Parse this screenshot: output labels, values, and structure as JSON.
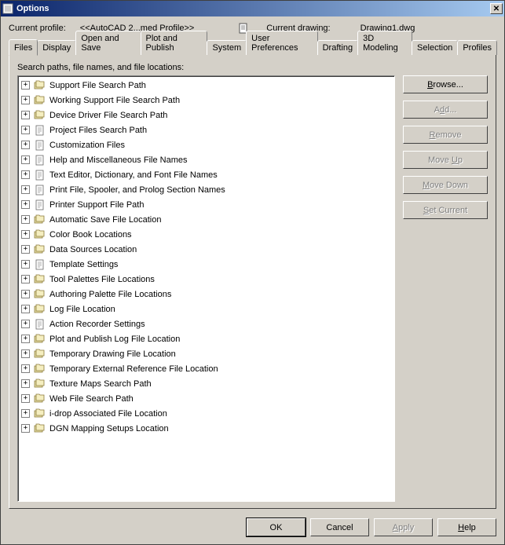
{
  "window": {
    "title": "Options"
  },
  "profile": {
    "label": "Current profile:",
    "value": "<<AutoCAD 2...med Profile>>",
    "drawing_label": "Current drawing:",
    "drawing_value": "Drawing1.dwg"
  },
  "tabs": [
    {
      "label": "Files",
      "active": true
    },
    {
      "label": "Display",
      "active": false
    },
    {
      "label": "Open and Save",
      "active": false
    },
    {
      "label": "Plot and Publish",
      "active": false
    },
    {
      "label": "System",
      "active": false
    },
    {
      "label": "User Preferences",
      "active": false
    },
    {
      "label": "Drafting",
      "active": false
    },
    {
      "label": "3D Modeling",
      "active": false
    },
    {
      "label": "Selection",
      "active": false
    },
    {
      "label": "Profiles",
      "active": false
    }
  ],
  "panel": {
    "label": "Search paths, file names, and file locations:"
  },
  "tree": [
    {
      "label": "Support File Search Path",
      "icon": "folders"
    },
    {
      "label": "Working Support File Search Path",
      "icon": "folders"
    },
    {
      "label": "Device Driver File Search Path",
      "icon": "folders"
    },
    {
      "label": "Project Files Search Path",
      "icon": "file"
    },
    {
      "label": "Customization Files",
      "icon": "file"
    },
    {
      "label": "Help and Miscellaneous File Names",
      "icon": "file"
    },
    {
      "label": "Text Editor, Dictionary, and Font File Names",
      "icon": "file"
    },
    {
      "label": "Print File, Spooler, and Prolog Section Names",
      "icon": "file"
    },
    {
      "label": "Printer Support File Path",
      "icon": "file"
    },
    {
      "label": "Automatic Save File Location",
      "icon": "folders"
    },
    {
      "label": "Color Book Locations",
      "icon": "folders"
    },
    {
      "label": "Data Sources Location",
      "icon": "folders"
    },
    {
      "label": "Template Settings",
      "icon": "file"
    },
    {
      "label": "Tool Palettes File Locations",
      "icon": "folders"
    },
    {
      "label": "Authoring Palette File Locations",
      "icon": "folders"
    },
    {
      "label": "Log File Location",
      "icon": "folders"
    },
    {
      "label": "Action Recorder Settings",
      "icon": "file"
    },
    {
      "label": "Plot and Publish Log File Location",
      "icon": "folders"
    },
    {
      "label": "Temporary Drawing File Location",
      "icon": "folders"
    },
    {
      "label": "Temporary External Reference File Location",
      "icon": "folders"
    },
    {
      "label": "Texture Maps Search Path",
      "icon": "folders"
    },
    {
      "label": "Web File Search Path",
      "icon": "folders"
    },
    {
      "label": "i-drop Associated File Location",
      "icon": "folders"
    },
    {
      "label": "DGN Mapping Setups Location",
      "icon": "folders"
    }
  ],
  "side_buttons": {
    "browse": "Browse...",
    "add": "Add...",
    "remove": "Remove",
    "moveup": "Move Up",
    "movedown": "Move Down",
    "setcurrent": "Set Current"
  },
  "bottom": {
    "ok": "OK",
    "cancel": "Cancel",
    "apply": "Apply",
    "help": "Help"
  }
}
